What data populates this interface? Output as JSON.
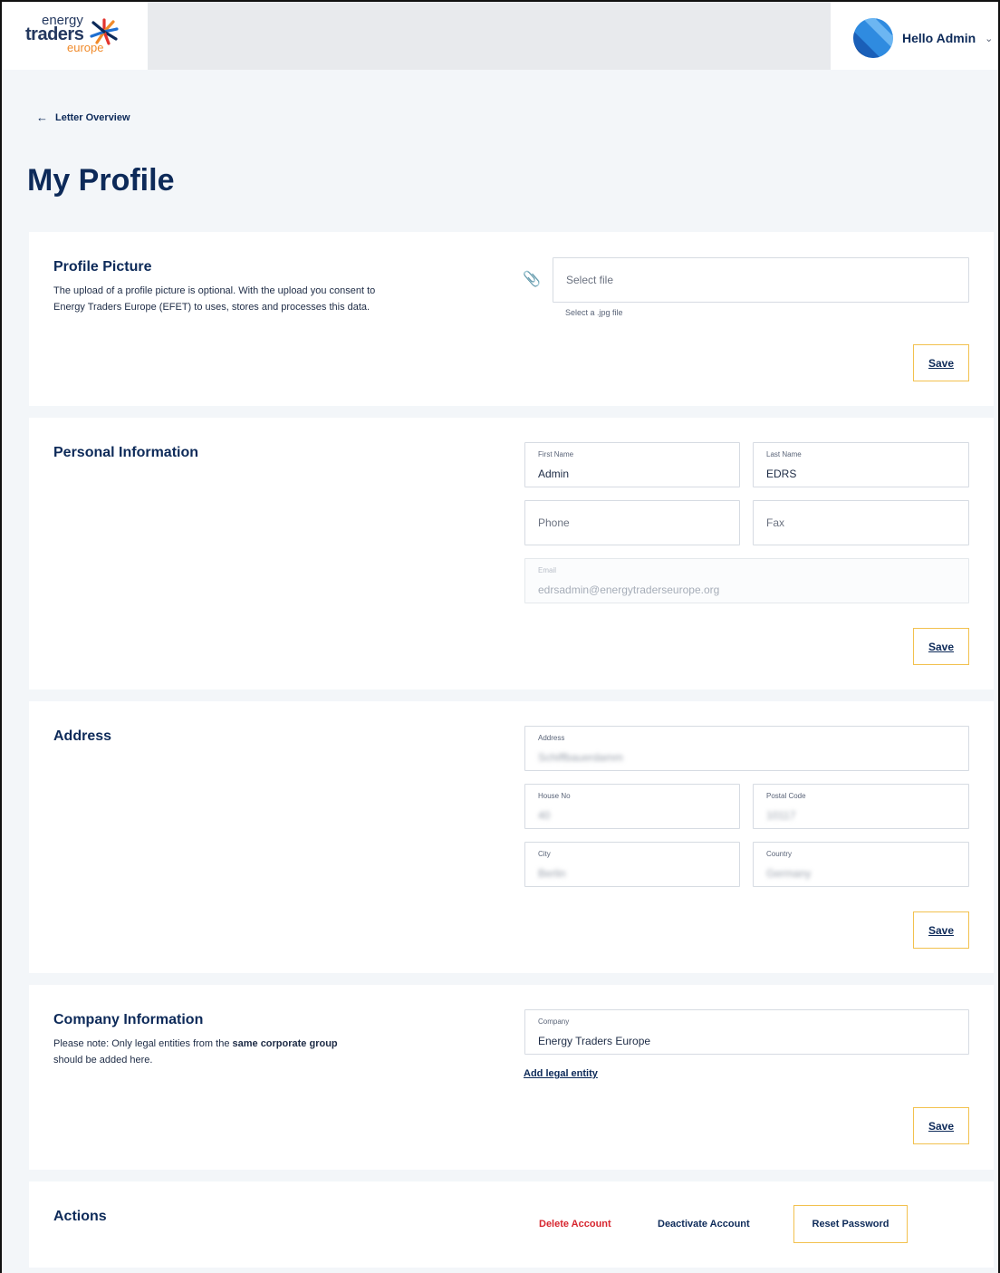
{
  "brand": {
    "line1": "energy",
    "line2": "traders",
    "line3": "europe"
  },
  "header": {
    "greeting": "Hello Admin"
  },
  "nav": {
    "back_label": "Letter Overview"
  },
  "page": {
    "title": "My Profile"
  },
  "profile_picture": {
    "title": "Profile Picture",
    "description": "The upload of a profile picture is optional. With the upload you consent to Energy Traders Europe (EFET) to uses, stores and processes this data.",
    "file_placeholder": "Select file",
    "file_hint": "Select a .jpg file",
    "save_label": "Save"
  },
  "personal": {
    "title": "Personal Information",
    "first_name_label": "First Name",
    "first_name_value": "Admin",
    "last_name_label": "Last Name",
    "last_name_value": "EDRS",
    "phone_placeholder": "Phone",
    "fax_placeholder": "Fax",
    "email_label": "Email",
    "email_value": "edrsadmin@energytraderseurope.org",
    "save_label": "Save"
  },
  "address": {
    "title": "Address",
    "address_label": "Address",
    "address_value": "Schiffbauerdamm",
    "house_no_label": "House No",
    "house_no_value": "40",
    "postal_code_label": "Postal Code",
    "postal_code_value": "10117",
    "city_label": "City",
    "city_value": "Berlin",
    "country_label": "Country",
    "country_value": "Germany",
    "save_label": "Save"
  },
  "company": {
    "title": "Company Information",
    "note_prefix": "Please note: Only legal entities from the ",
    "note_bold": "same corporate group",
    "note_suffix": "should be added here.",
    "company_label": "Company",
    "company_value": "Energy Traders Europe",
    "add_link": "Add legal entity",
    "save_label": "Save"
  },
  "actions": {
    "title": "Actions",
    "delete_label": "Delete Account",
    "deactivate_label": "Deactivate Account",
    "reset_label": "Reset Password"
  },
  "colors": {
    "navy": "#0d2a59",
    "danger": "#d7262f",
    "button_border": "#f2c14e",
    "background": "#f3f6f9"
  }
}
